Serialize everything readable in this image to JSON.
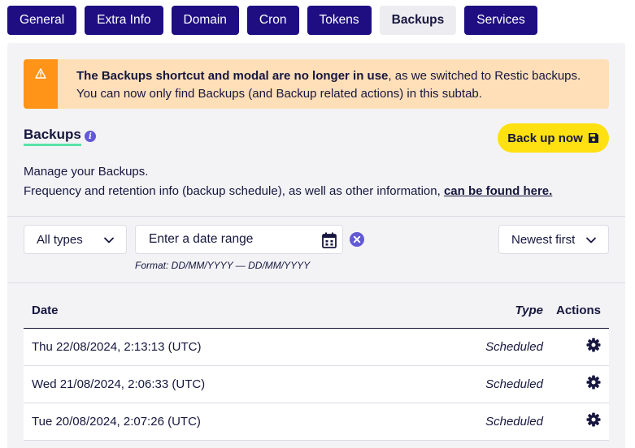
{
  "tabs": [
    {
      "label": "General"
    },
    {
      "label": "Extra Info"
    },
    {
      "label": "Domain"
    },
    {
      "label": "Cron"
    },
    {
      "label": "Tokens"
    },
    {
      "label": "Backups"
    },
    {
      "label": "Services"
    }
  ],
  "active_tab": "Backups",
  "alert": {
    "icon": "warning-icon",
    "bold_text": "The Backups shortcut and modal are no longer in use",
    "text1": ", as we switched to Restic backups.",
    "text2": "You can now only find Backups (and Backup related actions) in this subtab."
  },
  "section": {
    "title": "Backups",
    "info_icon": "info-icon",
    "backup_button": "Back up now",
    "backup_button_icon": "save-icon",
    "desc_line1": "Manage your Backups.",
    "desc_line2": "Frequency and retention info (backup schedule), as well as other information, ",
    "desc_link": "can be found here."
  },
  "filters": {
    "type_select": "All types",
    "date_placeholder": "Enter a date range",
    "date_format": "Format: DD/MM/YYYY — DD/MM/YYYY",
    "sort_select": "Newest first"
  },
  "table": {
    "headers": {
      "date": "Date",
      "type": "Type",
      "actions": "Actions"
    },
    "rows": [
      {
        "date": "Thu 22/08/2024, 2:13:13 (UTC)",
        "type": "Scheduled"
      },
      {
        "date": "Wed 21/08/2024, 2:06:33 (UTC)",
        "type": "Scheduled"
      },
      {
        "date": "Tue 20/08/2024, 2:07:26 (UTC)",
        "type": "Scheduled"
      }
    ]
  },
  "colors": {
    "tab_bg": "#1e0e82",
    "alert_bg": "#ffdfb8",
    "alert_bar": "#ff9419",
    "button_yellow": "#ffe011",
    "accent_purple": "#6259d6",
    "underline_green": "#59e3a7"
  }
}
